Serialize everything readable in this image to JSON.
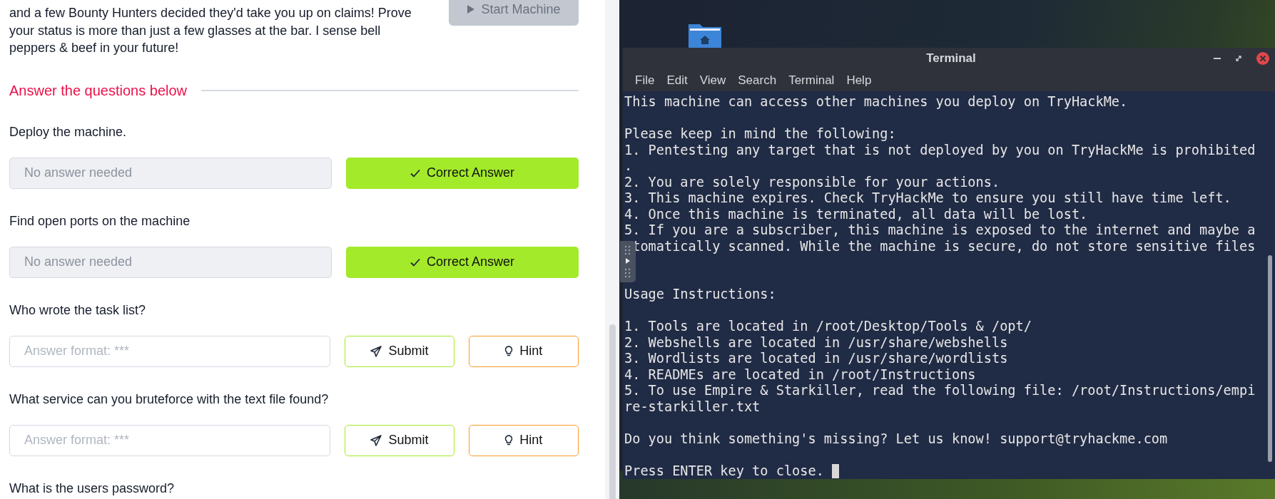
{
  "task": {
    "description_lines": [
      "and a few Bounty Hunters decided they'd take you up on claims! Prove",
      "your status is more than just a few glasses at the bar. I sense bell",
      "peppers & beef in your future!"
    ],
    "start_button": {
      "label": "Start Machine",
      "disabled": true
    },
    "section_title": "Answer the questions below",
    "questions": [
      {
        "question": "Deploy the machine.",
        "input": {
          "placeholder": "No answer needed",
          "disabled": true
        },
        "buttons": [
          {
            "kind": "correct",
            "label": "Correct Answer"
          }
        ]
      },
      {
        "question": "Find open ports on the machine",
        "input": {
          "placeholder": "No answer needed",
          "disabled": true
        },
        "buttons": [
          {
            "kind": "correct",
            "label": "Correct Answer"
          }
        ]
      },
      {
        "question": "Who wrote the task list?",
        "input": {
          "placeholder": "Answer format: ***",
          "disabled": false
        },
        "buttons": [
          {
            "kind": "submit",
            "label": "Submit"
          },
          {
            "kind": "hint",
            "label": "Hint"
          }
        ]
      },
      {
        "question": "What service can you bruteforce with the text file found?",
        "input": {
          "placeholder": "Answer format: ***",
          "disabled": false
        },
        "buttons": [
          {
            "kind": "submit",
            "label": "Submit"
          },
          {
            "kind": "hint",
            "label": "Hint"
          }
        ]
      },
      {
        "question": "What is the users password?"
      }
    ]
  },
  "terminal": {
    "title": "Terminal",
    "menu": [
      "File",
      "Edit",
      "View",
      "Search",
      "Terminal",
      "Help"
    ],
    "cursor_visible": true,
    "lines": [
      {
        "kind": "text",
        "text": "This machine can access other machines you deploy on TryHackMe."
      },
      {
        "kind": "blank"
      },
      {
        "kind": "text",
        "text": "Please keep in mind the following:"
      },
      {
        "kind": "text",
        "text": "1. Pentesting any target that is not deployed by you on TryHackMe is prohibited"
      },
      {
        "kind": "text",
        "text": "."
      },
      {
        "kind": "text",
        "text": "2. You are solely responsible for your actions."
      },
      {
        "kind": "text",
        "text": "3. This machine expires. Check TryHackMe to ensure you still have time left."
      },
      {
        "kind": "text",
        "text": "4. Once this machine is terminated, all data will be lost."
      },
      {
        "kind": "text",
        "text": "5. If you are a subscriber, this machine is exposed to the internet and maybe a"
      },
      {
        "kind": "covered",
        "text": "tomatically scanned. While the machine is secure, do not store sensitive files"
      },
      {
        "kind": "blank"
      },
      {
        "kind": "blank"
      },
      {
        "kind": "text",
        "text": "Usage Instructions:"
      },
      {
        "kind": "blank"
      },
      {
        "kind": "text",
        "text": "1. Tools are located in /root/Desktop/Tools & /opt/"
      },
      {
        "kind": "text",
        "text": "2. Webshells are located in /usr/share/webshells"
      },
      {
        "kind": "text",
        "text": "3. Wordlists are located in /usr/share/wordlists"
      },
      {
        "kind": "text",
        "text": "4. READMEs are located in /root/Instructions"
      },
      {
        "kind": "text",
        "text": "5. To use Empire & Starkiller, read the following file: /root/Instructions/empi"
      },
      {
        "kind": "text",
        "text": "re-starkiller.txt"
      },
      {
        "kind": "blank"
      },
      {
        "kind": "text",
        "text": "Do you think something's missing? Let us know! support@tryhackme.com"
      },
      {
        "kind": "blank"
      },
      {
        "kind": "prompt",
        "text": "Press ENTER key to close."
      }
    ]
  }
}
